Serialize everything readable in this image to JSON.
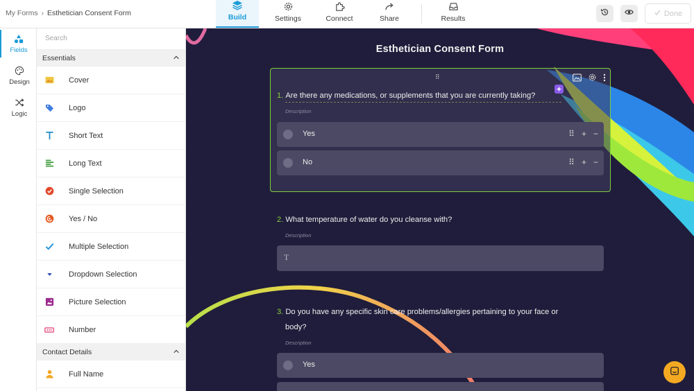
{
  "breadcrumb": {
    "parent": "My Forms",
    "separator": "›",
    "current": "Esthetician Consent Form"
  },
  "tabs": [
    {
      "label": "Build",
      "icon": "layers-icon",
      "active": true
    },
    {
      "label": "Settings",
      "icon": "gear-icon"
    },
    {
      "label": "Connect",
      "icon": "puzzle-icon"
    },
    {
      "label": "Share",
      "icon": "share-arrow-icon"
    },
    {
      "label": "Results",
      "icon": "inbox-icon"
    }
  ],
  "toolbar": {
    "done_label": "Done",
    "history_icon": "history-icon",
    "preview_icon": "eye-icon"
  },
  "rail": [
    {
      "label": "Fields",
      "icon": "shapes-icon",
      "active": true
    },
    {
      "label": "Design",
      "icon": "palette-icon"
    },
    {
      "label": "Logic",
      "icon": "shuffle-icon"
    }
  ],
  "panel": {
    "search_placeholder": "Search",
    "sections": [
      {
        "title": "Essentials",
        "items": [
          {
            "label": "Cover",
            "icon": "cover-icon"
          },
          {
            "label": "Logo",
            "icon": "tag-icon"
          },
          {
            "label": "Short Text",
            "icon": "text-t-icon"
          },
          {
            "label": "Long Text",
            "icon": "paragraph-icon"
          },
          {
            "label": "Single Selection",
            "icon": "check-circle-icon"
          },
          {
            "label": "Yes / No",
            "icon": "yes-no-icon"
          },
          {
            "label": "Multiple Selection",
            "icon": "checkmark-icon"
          },
          {
            "label": "Dropdown Selection",
            "icon": "dropdown-icon"
          },
          {
            "label": "Picture Selection",
            "icon": "picture-icon"
          },
          {
            "label": "Number",
            "icon": "number-icon"
          }
        ]
      },
      {
        "title": "Contact Details",
        "items": [
          {
            "label": "Full Name",
            "icon": "person-icon"
          }
        ]
      }
    ]
  },
  "canvas": {
    "form_title": "Esthetician Consent Form",
    "questions": [
      {
        "number": "1.",
        "text": "Are there any medications, or supplements that you are currently taking?",
        "description": "Description",
        "options": [
          "Yes",
          "No"
        ]
      },
      {
        "number": "2.",
        "text": "What temperature of water do you cleanse with?",
        "description": "Description",
        "input_glyph": "T"
      },
      {
        "number": "3.",
        "text_line1": "Do you have any specific skin care problems/allergies pertaining to your face or",
        "text_line2": "body?",
        "description": "Description",
        "options": [
          "Yes"
        ]
      }
    ]
  },
  "colors": {
    "accent": "#1a9bd7",
    "canvas_bg": "#1f1d3b",
    "selected_border": "#7fcf3c",
    "chat_button": "#f4a922"
  }
}
